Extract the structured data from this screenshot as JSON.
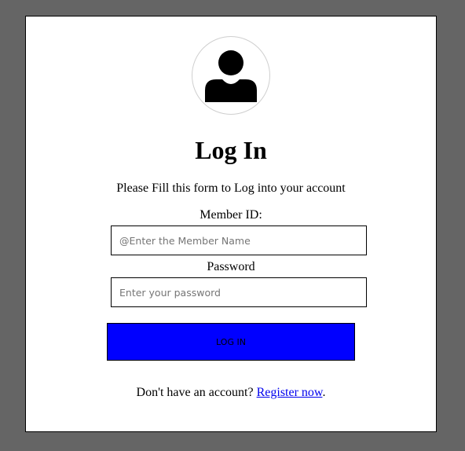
{
  "header": {
    "avatar_icon": "user-silhouette-icon",
    "title": "Log In",
    "subtitle": "Please Fill this form to Log into your account"
  },
  "form": {
    "member_label": "Member ID:",
    "member_placeholder": "@Enter the Member Name",
    "member_value": "",
    "password_label": "Password",
    "password_placeholder": "Enter your password",
    "password_value": "",
    "submit_label": "LOG IN"
  },
  "footer": {
    "prompt": "Don't have an account? ",
    "register_link": "Register now",
    "suffix": "."
  },
  "colors": {
    "page_background": "#656565",
    "card_background": "#ffffff",
    "button_background": "#0000ff",
    "link": "#0000ee"
  }
}
